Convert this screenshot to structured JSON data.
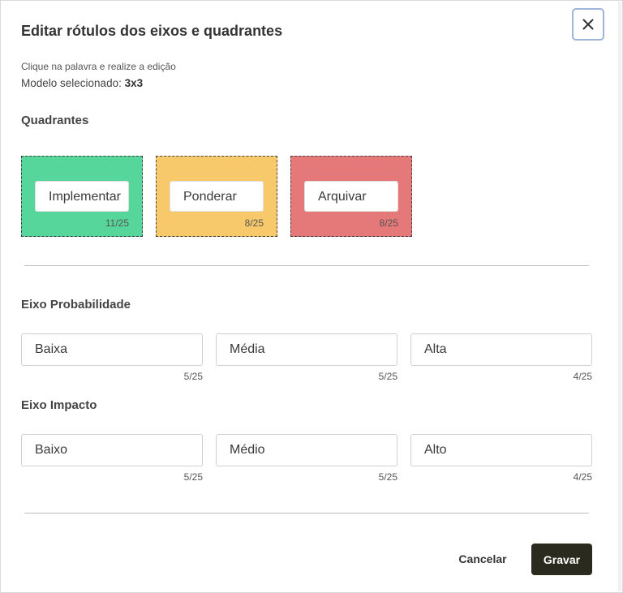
{
  "dialog": {
    "title": "Editar rótulos dos eixos e quadrantes",
    "hint": "Clique na palavra e realize a edição",
    "model_label": "Modelo selecionado:",
    "model_value": "3x3"
  },
  "quadrants": {
    "label": "Quadrantes",
    "items": [
      {
        "value": "Implementar",
        "count": "11/25",
        "color": "#57d69b"
      },
      {
        "value": "Ponderar",
        "count": "8/25",
        "color": "#f7c96b"
      },
      {
        "value": "Arquivar",
        "count": "8/25",
        "color": "#e57979"
      }
    ]
  },
  "probability_axis": {
    "label": "Eixo Probabilidade",
    "fields": [
      {
        "value": "Baixa",
        "count": "5/25"
      },
      {
        "value": "Média",
        "count": "5/25"
      },
      {
        "value": "Alta",
        "count": "4/25"
      }
    ]
  },
  "impact_axis": {
    "label": "Eixo Impacto",
    "fields": [
      {
        "value": "Baixo",
        "count": "5/25"
      },
      {
        "value": "Médio",
        "count": "5/25"
      },
      {
        "value": "Alto",
        "count": "4/25"
      }
    ]
  },
  "footer": {
    "cancel_label": "Cancelar",
    "save_label": "Gravar"
  },
  "icons": {
    "close": "close-icon"
  }
}
